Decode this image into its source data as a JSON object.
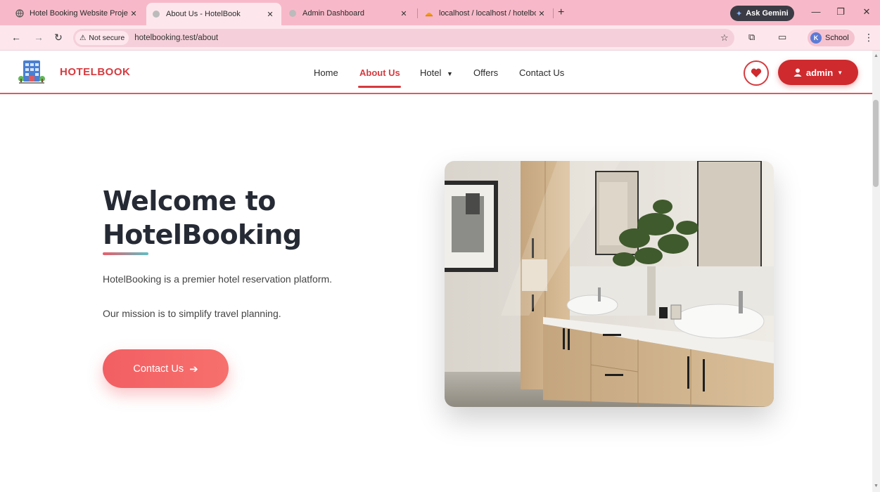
{
  "browser": {
    "tabs": [
      {
        "title": "Hotel Booking Website Project",
        "active": false
      },
      {
        "title": "About Us - HotelBook",
        "active": true
      },
      {
        "title": "Admin Dashboard",
        "active": false
      },
      {
        "title": "localhost / localhost / hotelboo",
        "active": false
      }
    ],
    "new_tab": "+",
    "ask_gemini": "Ask Gemini",
    "security_chip": "Not secure",
    "url": "hotelbooking.test/about",
    "profile_initial": "K",
    "profile_name": "School"
  },
  "site": {
    "brand": "HOTELBOOK",
    "menu": {
      "home": "Home",
      "about": "About Us",
      "hotel": "Hotel",
      "offers": "Offers",
      "contact": "Contact Us"
    },
    "user_label": "admin",
    "accent_color": "#d63b3f"
  },
  "hero": {
    "title_line1": "Welcome to",
    "title_line2": "HotelBooking",
    "paragraph1": "HotelBooking is a premier hotel reservation platform.",
    "paragraph2": "Our mission is to simplify travel planning.",
    "cta_label": "Contact Us"
  }
}
